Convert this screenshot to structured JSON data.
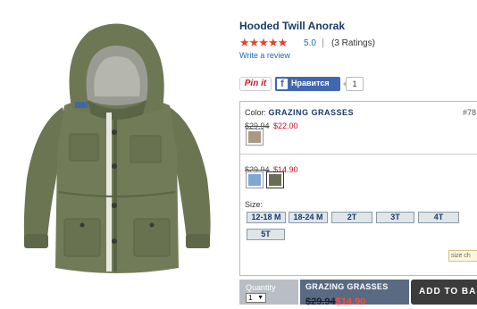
{
  "product": {
    "title": "Hooded Twill Anorak",
    "stars": "★★★★★",
    "rating": "5.0",
    "rating_sep": "|",
    "ratings_count": "(3 Ratings)",
    "write_review": "Write a review"
  },
  "social": {
    "pinit": "Pin it",
    "fb_icon": "f",
    "fb_like": "Нравится",
    "fb_count": "1"
  },
  "options": {
    "color_prefix": "Color: ",
    "color_value": "GRAZING GRASSES",
    "item_no": "#78",
    "group1": {
      "was": "$29.94",
      "now": "$22.00"
    },
    "group2": {
      "was": "$29.94",
      "now": "$14.90"
    },
    "size_label": "Size:",
    "sizes": [
      "12-18 M",
      "18-24 M",
      "2T",
      "3T",
      "4T",
      "5T"
    ],
    "size_chart": "size ch",
    "swatch_colors": {
      "tan": "#a99983",
      "blue": "#7fa7d6",
      "green": "#6a6c55"
    }
  },
  "bottom_bar": {
    "quantity_label": "Quantity",
    "quantity_value": "1",
    "summary_color": "GRAZING GRASSES",
    "summary_was": "$29.94",
    "summary_now": "$14.90",
    "add_to_bag": "ADD TO BA"
  },
  "colors": {
    "title": "#1a3a6b",
    "star": "#e8412c",
    "sale": "#c8102e",
    "summary_bg": "#5a6a82",
    "add_to_bag_bg": "#3c3c3c"
  }
}
